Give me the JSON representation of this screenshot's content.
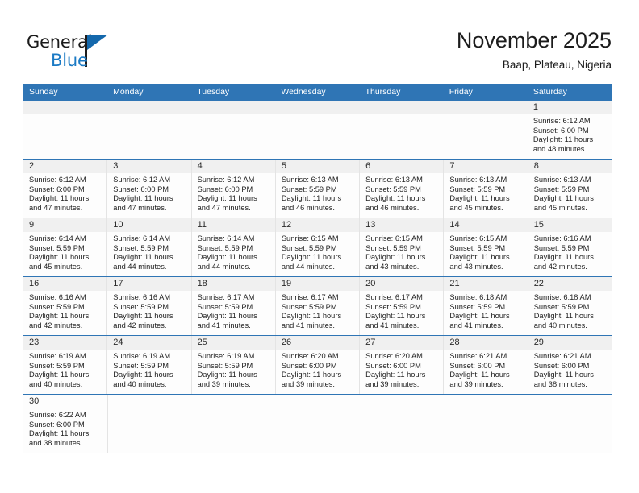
{
  "brand": {
    "name_part1": "General",
    "name_part2": "Blue",
    "triangle_icon": "triangle-icon",
    "accent_color": "#1b7ac4",
    "dark_color": "#1a1a1a"
  },
  "header": {
    "title": "November 2025",
    "subtitle": "Baap, Plateau, Nigeria"
  },
  "calendar": {
    "header_bg": "#2f75b5",
    "day_band_bg": "#f0f0f0",
    "weekdays": [
      "Sunday",
      "Monday",
      "Tuesday",
      "Wednesday",
      "Thursday",
      "Friday",
      "Saturday"
    ],
    "weeks": [
      [
        {
          "day": "",
          "sunrise": "",
          "sunset": "",
          "daylight_line1": "",
          "daylight_line2": ""
        },
        {
          "day": "",
          "sunrise": "",
          "sunset": "",
          "daylight_line1": "",
          "daylight_line2": ""
        },
        {
          "day": "",
          "sunrise": "",
          "sunset": "",
          "daylight_line1": "",
          "daylight_line2": ""
        },
        {
          "day": "",
          "sunrise": "",
          "sunset": "",
          "daylight_line1": "",
          "daylight_line2": ""
        },
        {
          "day": "",
          "sunrise": "",
          "sunset": "",
          "daylight_line1": "",
          "daylight_line2": ""
        },
        {
          "day": "",
          "sunrise": "",
          "sunset": "",
          "daylight_line1": "",
          "daylight_line2": ""
        },
        {
          "day": "1",
          "sunrise": "Sunrise: 6:12 AM",
          "sunset": "Sunset: 6:00 PM",
          "daylight_line1": "Daylight: 11 hours",
          "daylight_line2": "and 48 minutes."
        }
      ],
      [
        {
          "day": "2",
          "sunrise": "Sunrise: 6:12 AM",
          "sunset": "Sunset: 6:00 PM",
          "daylight_line1": "Daylight: 11 hours",
          "daylight_line2": "and 47 minutes."
        },
        {
          "day": "3",
          "sunrise": "Sunrise: 6:12 AM",
          "sunset": "Sunset: 6:00 PM",
          "daylight_line1": "Daylight: 11 hours",
          "daylight_line2": "and 47 minutes."
        },
        {
          "day": "4",
          "sunrise": "Sunrise: 6:12 AM",
          "sunset": "Sunset: 6:00 PM",
          "daylight_line1": "Daylight: 11 hours",
          "daylight_line2": "and 47 minutes."
        },
        {
          "day": "5",
          "sunrise": "Sunrise: 6:13 AM",
          "sunset": "Sunset: 5:59 PM",
          "daylight_line1": "Daylight: 11 hours",
          "daylight_line2": "and 46 minutes."
        },
        {
          "day": "6",
          "sunrise": "Sunrise: 6:13 AM",
          "sunset": "Sunset: 5:59 PM",
          "daylight_line1": "Daylight: 11 hours",
          "daylight_line2": "and 46 minutes."
        },
        {
          "day": "7",
          "sunrise": "Sunrise: 6:13 AM",
          "sunset": "Sunset: 5:59 PM",
          "daylight_line1": "Daylight: 11 hours",
          "daylight_line2": "and 45 minutes."
        },
        {
          "day": "8",
          "sunrise": "Sunrise: 6:13 AM",
          "sunset": "Sunset: 5:59 PM",
          "daylight_line1": "Daylight: 11 hours",
          "daylight_line2": "and 45 minutes."
        }
      ],
      [
        {
          "day": "9",
          "sunrise": "Sunrise: 6:14 AM",
          "sunset": "Sunset: 5:59 PM",
          "daylight_line1": "Daylight: 11 hours",
          "daylight_line2": "and 45 minutes."
        },
        {
          "day": "10",
          "sunrise": "Sunrise: 6:14 AM",
          "sunset": "Sunset: 5:59 PM",
          "daylight_line1": "Daylight: 11 hours",
          "daylight_line2": "and 44 minutes."
        },
        {
          "day": "11",
          "sunrise": "Sunrise: 6:14 AM",
          "sunset": "Sunset: 5:59 PM",
          "daylight_line1": "Daylight: 11 hours",
          "daylight_line2": "and 44 minutes."
        },
        {
          "day": "12",
          "sunrise": "Sunrise: 6:15 AM",
          "sunset": "Sunset: 5:59 PM",
          "daylight_line1": "Daylight: 11 hours",
          "daylight_line2": "and 44 minutes."
        },
        {
          "day": "13",
          "sunrise": "Sunrise: 6:15 AM",
          "sunset": "Sunset: 5:59 PM",
          "daylight_line1": "Daylight: 11 hours",
          "daylight_line2": "and 43 minutes."
        },
        {
          "day": "14",
          "sunrise": "Sunrise: 6:15 AM",
          "sunset": "Sunset: 5:59 PM",
          "daylight_line1": "Daylight: 11 hours",
          "daylight_line2": "and 43 minutes."
        },
        {
          "day": "15",
          "sunrise": "Sunrise: 6:16 AM",
          "sunset": "Sunset: 5:59 PM",
          "daylight_line1": "Daylight: 11 hours",
          "daylight_line2": "and 42 minutes."
        }
      ],
      [
        {
          "day": "16",
          "sunrise": "Sunrise: 6:16 AM",
          "sunset": "Sunset: 5:59 PM",
          "daylight_line1": "Daylight: 11 hours",
          "daylight_line2": "and 42 minutes."
        },
        {
          "day": "17",
          "sunrise": "Sunrise: 6:16 AM",
          "sunset": "Sunset: 5:59 PM",
          "daylight_line1": "Daylight: 11 hours",
          "daylight_line2": "and 42 minutes."
        },
        {
          "day": "18",
          "sunrise": "Sunrise: 6:17 AM",
          "sunset": "Sunset: 5:59 PM",
          "daylight_line1": "Daylight: 11 hours",
          "daylight_line2": "and 41 minutes."
        },
        {
          "day": "19",
          "sunrise": "Sunrise: 6:17 AM",
          "sunset": "Sunset: 5:59 PM",
          "daylight_line1": "Daylight: 11 hours",
          "daylight_line2": "and 41 minutes."
        },
        {
          "day": "20",
          "sunrise": "Sunrise: 6:17 AM",
          "sunset": "Sunset: 5:59 PM",
          "daylight_line1": "Daylight: 11 hours",
          "daylight_line2": "and 41 minutes."
        },
        {
          "day": "21",
          "sunrise": "Sunrise: 6:18 AM",
          "sunset": "Sunset: 5:59 PM",
          "daylight_line1": "Daylight: 11 hours",
          "daylight_line2": "and 41 minutes."
        },
        {
          "day": "22",
          "sunrise": "Sunrise: 6:18 AM",
          "sunset": "Sunset: 5:59 PM",
          "daylight_line1": "Daylight: 11 hours",
          "daylight_line2": "and 40 minutes."
        }
      ],
      [
        {
          "day": "23",
          "sunrise": "Sunrise: 6:19 AM",
          "sunset": "Sunset: 5:59 PM",
          "daylight_line1": "Daylight: 11 hours",
          "daylight_line2": "and 40 minutes."
        },
        {
          "day": "24",
          "sunrise": "Sunrise: 6:19 AM",
          "sunset": "Sunset: 5:59 PM",
          "daylight_line1": "Daylight: 11 hours",
          "daylight_line2": "and 40 minutes."
        },
        {
          "day": "25",
          "sunrise": "Sunrise: 6:19 AM",
          "sunset": "Sunset: 5:59 PM",
          "daylight_line1": "Daylight: 11 hours",
          "daylight_line2": "and 39 minutes."
        },
        {
          "day": "26",
          "sunrise": "Sunrise: 6:20 AM",
          "sunset": "Sunset: 6:00 PM",
          "daylight_line1": "Daylight: 11 hours",
          "daylight_line2": "and 39 minutes."
        },
        {
          "day": "27",
          "sunrise": "Sunrise: 6:20 AM",
          "sunset": "Sunset: 6:00 PM",
          "daylight_line1": "Daylight: 11 hours",
          "daylight_line2": "and 39 minutes."
        },
        {
          "day": "28",
          "sunrise": "Sunrise: 6:21 AM",
          "sunset": "Sunset: 6:00 PM",
          "daylight_line1": "Daylight: 11 hours",
          "daylight_line2": "and 39 minutes."
        },
        {
          "day": "29",
          "sunrise": "Sunrise: 6:21 AM",
          "sunset": "Sunset: 6:00 PM",
          "daylight_line1": "Daylight: 11 hours",
          "daylight_line2": "and 38 minutes."
        }
      ],
      [
        {
          "day": "30",
          "sunrise": "Sunrise: 6:22 AM",
          "sunset": "Sunset: 6:00 PM",
          "daylight_line1": "Daylight: 11 hours",
          "daylight_line2": "and 38 minutes."
        },
        {
          "day": "",
          "sunrise": "",
          "sunset": "",
          "daylight_line1": "",
          "daylight_line2": ""
        },
        {
          "day": "",
          "sunrise": "",
          "sunset": "",
          "daylight_line1": "",
          "daylight_line2": ""
        },
        {
          "day": "",
          "sunrise": "",
          "sunset": "",
          "daylight_line1": "",
          "daylight_line2": ""
        },
        {
          "day": "",
          "sunrise": "",
          "sunset": "",
          "daylight_line1": "",
          "daylight_line2": ""
        },
        {
          "day": "",
          "sunrise": "",
          "sunset": "",
          "daylight_line1": "",
          "daylight_line2": ""
        },
        {
          "day": "",
          "sunrise": "",
          "sunset": "",
          "daylight_line1": "",
          "daylight_line2": ""
        }
      ]
    ]
  }
}
